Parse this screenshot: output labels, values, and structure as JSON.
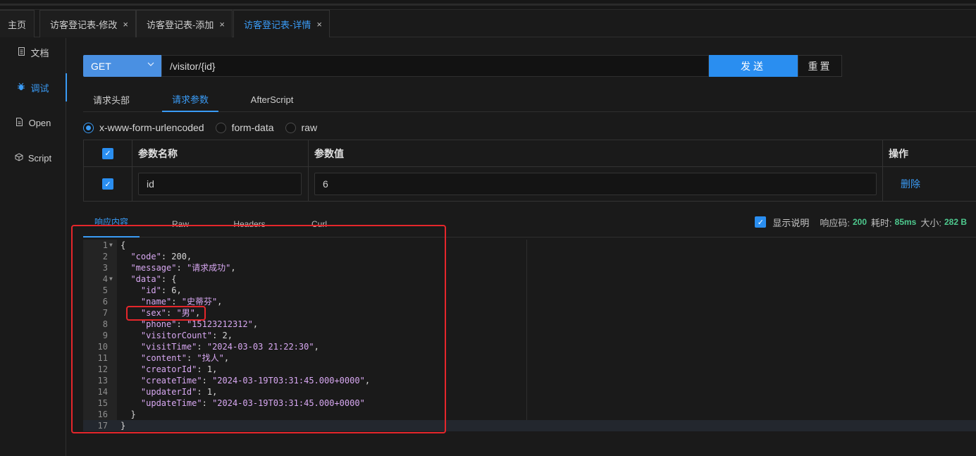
{
  "tabs": [
    {
      "label": "主页",
      "closable": false
    },
    {
      "label": "访客登记表-修改",
      "closable": true
    },
    {
      "label": "访客登记表-添加",
      "closable": true
    },
    {
      "label": "访客登记表-详情",
      "closable": true,
      "active": true
    }
  ],
  "tab_close_glyph": "×",
  "sidebar": {
    "items": [
      {
        "label": "文档",
        "icon": "document-icon"
      },
      {
        "label": "调试",
        "icon": "bug-icon",
        "active": true
      },
      {
        "label": "Open",
        "icon": "file-icon"
      },
      {
        "label": "Script",
        "icon": "code-icon"
      }
    ]
  },
  "request": {
    "method": "GET",
    "url": "/visitor/{id}",
    "send_label": "发送",
    "reset_label": "重置"
  },
  "request_tabs": [
    {
      "label": "请求头部"
    },
    {
      "label": "请求参数",
      "active": true
    },
    {
      "label": "AfterScript"
    }
  ],
  "content_types": [
    {
      "label": "x-www-form-urlencoded",
      "selected": true
    },
    {
      "label": "form-data"
    },
    {
      "label": "raw"
    }
  ],
  "params_table": {
    "headers": [
      "参数名称",
      "参数值",
      "操作"
    ],
    "rows": [
      {
        "checked": true,
        "name": "id",
        "value": "6",
        "action": "删除"
      }
    ]
  },
  "response_tabs": [
    {
      "label": "响应内容",
      "active": true
    },
    {
      "label": "Raw"
    },
    {
      "label": "Headers"
    },
    {
      "label": "Curl"
    }
  ],
  "response_info": {
    "show_desc_label": "显示说明",
    "status_label": "响应码:",
    "status": "200",
    "time_label": "耗时:",
    "time": "85ms",
    "size_label": "大小:",
    "size": "282 B"
  },
  "response_body": [
    "{",
    "  \"code\": 200,",
    "  \"message\": \"请求成功\",",
    "  \"data\": {",
    "    \"id\": 6,",
    "    \"name\": \"史蒂芬\",",
    "    \"sex\": \"男\",",
    "    \"phone\": \"15123212312\",",
    "    \"visitorCount\": 2,",
    "    \"visitTime\": \"2024-03-03 21:22:30\",",
    "    \"content\": \"找人\",",
    "    \"creatorId\": 1,",
    "    \"createTime\": \"2024-03-19T03:31:45.000+0000\",",
    "    \"updaterId\": 1,",
    "    \"updateTime\": \"2024-03-19T03:31:45.000+0000\"",
    "  }",
    "}"
  ],
  "colors": {
    "accent": "#2a8ef0",
    "annotation": "#e5262b",
    "success": "#4ec98e"
  }
}
